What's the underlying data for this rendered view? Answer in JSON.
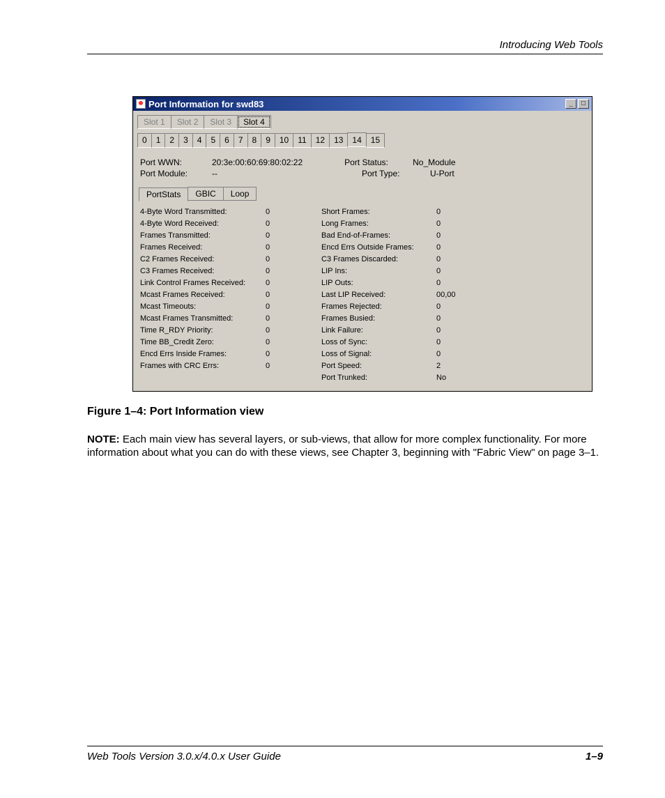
{
  "page": {
    "header": "Introducing Web Tools",
    "caption": "Figure 1–4:  Port Information view",
    "note_label": "NOTE:",
    "note_text": "  Each main view has several layers, or sub-views, that allow for more complex functionality. For more information about what you can do with these views, see Chapter 3, beginning with \"Fabric View\" on page 3–1.",
    "footer_left": "Web Tools Version 3.0.x/4.0.x User Guide",
    "footer_right": "1–9"
  },
  "window": {
    "title": "Port Information for swd83",
    "slot_tabs": [
      "Slot 1",
      "Slot 2",
      "Slot 3",
      "Slot 4"
    ],
    "slot_selected_index": 3,
    "num_tabs": [
      "0",
      "1",
      "2",
      "3",
      "4",
      "5",
      "6",
      "7",
      "8",
      "9",
      "10",
      "11",
      "12",
      "13",
      "14",
      "15"
    ],
    "num_selected_index": 14,
    "info": {
      "left": [
        {
          "label": "Port WWN:",
          "value": "20:3e:00:60:69:80:02:22"
        },
        {
          "label": "Port Module:",
          "value": "--"
        }
      ],
      "right": [
        {
          "label": "Port Status:",
          "value": "No_Module"
        },
        {
          "label": "Port Type:",
          "value": "U-Port"
        }
      ]
    },
    "stat_tabs": [
      "PortStats",
      "GBIC",
      "Loop"
    ],
    "stat_selected_index": 0,
    "stats_left": [
      {
        "label": "4-Byte Word Transmitted:",
        "value": "0"
      },
      {
        "label": "4-Byte Word Received:",
        "value": "0"
      },
      {
        "label": "Frames Transmitted:",
        "value": "0"
      },
      {
        "label": "Frames Received:",
        "value": "0"
      },
      {
        "label": "C2 Frames Received:",
        "value": "0"
      },
      {
        "label": "C3 Frames Received:",
        "value": "0"
      },
      {
        "label": "Link Control Frames Received:",
        "value": "0"
      },
      {
        "label": "Mcast Frames Received:",
        "value": "0"
      },
      {
        "label": "Mcast Timeouts:",
        "value": "0"
      },
      {
        "label": "Mcast Frames Transmitted:",
        "value": "0"
      },
      {
        "label": "Time R_RDY Priority:",
        "value": "0"
      },
      {
        "label": "Time BB_Credit Zero:",
        "value": "0"
      },
      {
        "label": "Encd Errs Inside Frames:",
        "value": "0"
      },
      {
        "label": "Frames with CRC Errs:",
        "value": "0"
      }
    ],
    "stats_right": [
      {
        "label": "Short Frames:",
        "value": "0"
      },
      {
        "label": "Long Frames:",
        "value": "0"
      },
      {
        "label": "Bad End-of-Frames:",
        "value": "0"
      },
      {
        "label": "Encd Errs Outside Frames:",
        "value": "0"
      },
      {
        "label": "C3 Frames Discarded:",
        "value": "0"
      },
      {
        "label": "LIP Ins:",
        "value": "0"
      },
      {
        "label": "LIP Outs:",
        "value": "0"
      },
      {
        "label": "Last LIP Received:",
        "value": "00,00"
      },
      {
        "label": "Frames Rejected:",
        "value": "0"
      },
      {
        "label": "Frames Busied:",
        "value": "0"
      },
      {
        "label": "Link Failure:",
        "value": "0"
      },
      {
        "label": "Loss of Sync:",
        "value": "0"
      },
      {
        "label": "Loss of Signal:",
        "value": "0"
      },
      {
        "label": "Port Speed:",
        "value": "2"
      },
      {
        "label": "Port Trunked:",
        "value": "No"
      }
    ]
  }
}
